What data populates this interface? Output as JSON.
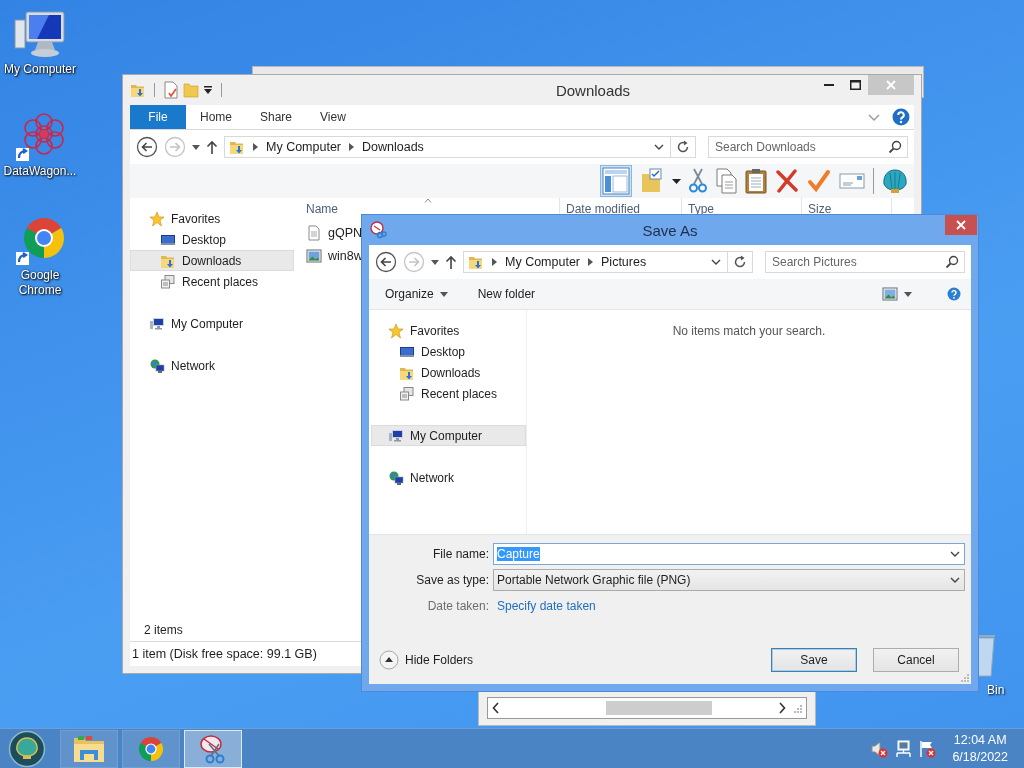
{
  "desktop_icons": [
    {
      "label": "My Computer",
      "kind": "computer",
      "shortcut": false
    },
    {
      "label": "DataWagon...",
      "kind": "datawagon",
      "shortcut": true
    },
    {
      "label": "Google Chrome",
      "kind": "chrome",
      "shortcut": true
    }
  ],
  "recycle_bin": {
    "label": "Bin"
  },
  "explorer": {
    "title": "Downloads",
    "ribbon_tabs": [
      {
        "label": "File",
        "kind": "menu"
      },
      {
        "label": "Home",
        "kind": "tab"
      },
      {
        "label": "Share",
        "kind": "tab"
      },
      {
        "label": "View",
        "kind": "tab"
      }
    ],
    "breadcrumb": [
      "My Computer",
      "Downloads"
    ],
    "search": {
      "placeholder": "Search Downloads"
    },
    "nav": [
      {
        "label": "Favorites",
        "kind": "star",
        "selected": false,
        "children": [
          {
            "label": "Desktop",
            "kind": "desktop",
            "selected": false
          },
          {
            "label": "Downloads",
            "kind": "downloads",
            "selected": true
          },
          {
            "label": "Recent places",
            "kind": "recent",
            "selected": false
          }
        ]
      },
      {
        "label": "My Computer",
        "kind": "computer",
        "selected": false
      },
      {
        "label": "Network",
        "kind": "network",
        "selected": false
      }
    ],
    "columns": [
      "Name",
      "Date modified",
      "Type",
      "Size"
    ],
    "files": [
      {
        "name": "gQPN",
        "kind": "document"
      },
      {
        "name": "win8w",
        "kind": "image"
      }
    ],
    "item_count": "2 items",
    "status": "1 item (Disk free space: 99.1 GB)"
  },
  "save_dialog": {
    "title": "Save As",
    "breadcrumb": [
      "My Computer",
      "Pictures"
    ],
    "search": {
      "placeholder": "Search Pictures"
    },
    "commands": [
      {
        "label": "Organize",
        "dropdown": true
      },
      {
        "label": "New folder",
        "dropdown": false
      }
    ],
    "nav": [
      {
        "label": "Favorites",
        "kind": "star",
        "selected": false,
        "children": [
          {
            "label": "Desktop",
            "kind": "desktop",
            "selected": false
          },
          {
            "label": "Downloads",
            "kind": "downloads",
            "selected": false
          },
          {
            "label": "Recent places",
            "kind": "recent",
            "selected": false
          }
        ]
      },
      {
        "label": "My Computer",
        "kind": "computer",
        "selected": true
      },
      {
        "label": "Network",
        "kind": "network",
        "selected": false
      }
    ],
    "empty_message": "No items match your search.",
    "fields": [
      {
        "label": "File name:",
        "value": "Capture",
        "kind": "combo",
        "highlighted": true
      },
      {
        "label": "Save as type:",
        "value": "Portable Network Graphic file (PNG)",
        "kind": "select"
      },
      {
        "label": "Date taken:",
        "value": "Specify date taken",
        "kind": "link"
      }
    ],
    "hide_folders": "Hide Folders",
    "buttons": [
      {
        "label": "Save",
        "default": true
      },
      {
        "label": "Cancel",
        "default": false
      }
    ]
  },
  "taskbar": {
    "apps": [
      {
        "kind": "explorer",
        "active": false
      },
      {
        "kind": "chrome",
        "active": false
      },
      {
        "kind": "snipping",
        "active": true
      }
    ],
    "time": "12:04 AM",
    "date": "6/18/2022"
  }
}
